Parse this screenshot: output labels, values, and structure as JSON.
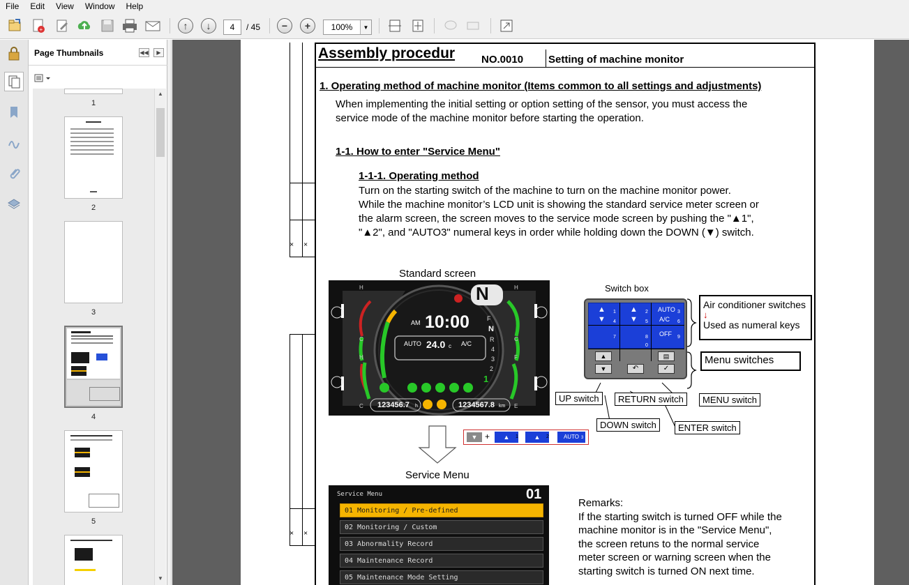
{
  "menu": [
    "File",
    "Edit",
    "View",
    "Window",
    "Help"
  ],
  "toolbar": {
    "page_current": "4",
    "page_total": "/ 45",
    "zoom": "100%"
  },
  "sidebar": {
    "title": "Page Thumbnails",
    "thumbs": [
      "1",
      "2",
      "3",
      "4",
      "5"
    ]
  },
  "doc": {
    "header_title": "Assembly procedur",
    "header_no": "NO.0010",
    "header_subject": "Setting of machine monitor",
    "section1": "1. Operating method of machine monitor (Items common to all settings and adjustments)",
    "section1_p1": "When implementing the initial setting or option setting of the sensor, you must access the",
    "section1_p2": "service mode of the machine monitor before starting the operation.",
    "sub11": "1-1. How to enter \"Service Menu\"",
    "sub111": "1-1-1. Operating method",
    "body1": "Turn on the starting switch of the machine to turn on the machine monitor power.",
    "body2": "While the machine monitor’s LCD unit is showing the standard service meter screen or",
    "body3": "the alarm screen, the screen moves to the service mode screen by pushing the \"▲1\",",
    "body4": "\"▲2\", and \"AUTO3\" numeral keys in order while holding down the DOWN (▼) switch.",
    "std_caption": "Standard screen",
    "switch_caption": "Switch box",
    "svc_caption": "Service Menu",
    "monitor": {
      "gear": "N",
      "time_am": "AM",
      "time": "10:00",
      "auto": "AUTO",
      "temp": "24.0",
      "temp_unit": "c",
      "ac": "A/C",
      "hours": "123456.7",
      "hours_unit": "h",
      "odo": "1234567.8",
      "odo_unit": "km",
      "gear_scale": [
        "F",
        "N",
        "R",
        "4",
        "3",
        "2",
        "1"
      ],
      "H": "H",
      "C": "C",
      "F": "F",
      "E": "E"
    },
    "switchbox": {
      "auto": "AUTO",
      "ac": "A/C",
      "off": "OFF",
      "nums": [
        "1",
        "2",
        "3",
        "4",
        "5",
        "6",
        "7",
        "8",
        "9",
        "0"
      ]
    },
    "labels": {
      "air": "Air conditioner switches",
      "numeral": "Used as numeral keys",
      "menu_sw": "Menu switches",
      "up": "UP switch",
      "return": "RETURN switch",
      "menu": "MENU switch",
      "down": "DOWN switch",
      "enter": "ENTER switch"
    },
    "keyseq": {
      "plus": "+",
      "k1": "1",
      "k2": "2",
      "k3": "AUTO",
      "k3n": "3"
    },
    "service_menu": {
      "title": "Service Menu",
      "num": "01",
      "items": [
        "01  Monitoring / Pre-defined",
        "02  Monitoring / Custom",
        "03  Abnormality Record",
        "04  Maintenance Record",
        "05  Maintenance Mode Setting"
      ]
    },
    "remarks": {
      "title": "Remarks:",
      "lines": [
        "If the starting switch is turned OFF while the",
        "machine monitor is in the \"Service Menu\",",
        "the screen retuns to the normal service",
        "meter screen or warning screen when the",
        "starting switch is turned ON next time."
      ]
    },
    "margin_marks": [
      "×",
      "×"
    ]
  },
  "colors": {
    "accent_red": "#cc0000",
    "switch_blue": "#1b3fd8",
    "menu_highlight": "#f5b400",
    "monitor_bg": "#0c0c0c",
    "gauge_green": "#28c828"
  }
}
